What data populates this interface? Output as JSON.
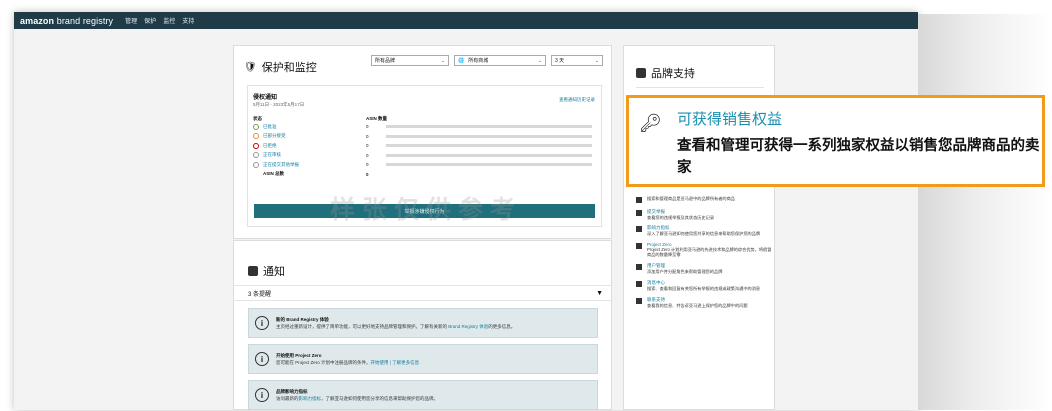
{
  "topbar": {
    "logo_bold": "amazon",
    "logo_rest": "brand registry",
    "nav": [
      "管理",
      "保护",
      "监控",
      "支持"
    ]
  },
  "protect": {
    "title": "保护和监控",
    "filters": [
      "所有品牌",
      "所有商城",
      "3 天"
    ],
    "notice_title": "侵权通知",
    "date_range": "5月11日 - 2023年5月17日",
    "history_link": "查看通知历史记录",
    "col_status": "状态",
    "col_asin": "ASIN 数量",
    "rows": [
      {
        "label": "已批准",
        "count": "0",
        "color": "#6aa84f"
      },
      {
        "label": "已部分接受",
        "count": "0",
        "color": "#e69138"
      },
      {
        "label": "已拒绝",
        "count": "0",
        "color": "#cc0000"
      },
      {
        "label": "正在审核",
        "count": "0",
        "color": "#999999"
      },
      {
        "label": "正在提交其他举报",
        "count": "0",
        "color": "#999999"
      }
    ],
    "total_label": "ASIN 总数",
    "total_value": "0",
    "button_label": "举报涉嫌侵权行为"
  },
  "watermark": "样张仅供参考",
  "notice": {
    "title": "通知",
    "count_label": "3 条提醒",
    "items": [
      {
        "title": "新的 Brand Registry 体验",
        "body_a": "主页经过重新设计，提供了简单功能，可以更好地支持品牌管理和保护。了解有关新的 ",
        "body_link": "Brand Registry 体验",
        "body_b": "的更多信息。"
      },
      {
        "title": "开始使用 Project Zero",
        "body_a": "您可能在 Project Zero 计划中注册品牌的条件。",
        "body_link": "开始使用 | 了解更多信息",
        "body_b": ""
      },
      {
        "title": "品牌影响力指标",
        "body_a": "访问最新的",
        "body_link": "影响力指标",
        "body_b": "，了解亚马逊如何使用您分享的信息来帮助保护您的品牌。"
      }
    ]
  },
  "support": {
    "title": "品牌支持",
    "quick_links": "快捷链接",
    "items": [
      {
        "label": "",
        "desc": "搜索和管理商品是亚马逊中的品牌所有者的商品"
      },
      {
        "label": "提交举报",
        "desc": "查看您的违规举报及其状态历史记录"
      },
      {
        "label": "影响力指标",
        "desc": "深入了解亚马逊如何使用您共享的信息来帮助您保护您的品牌"
      },
      {
        "label": "Project Zero",
        "desc": "Project Zero 计划利用亚马逊的先进技术和品牌的综合优势，将假冒商品的数量降至零"
      },
      {
        "label": "用户管理",
        "desc": "添加用户并分配角色来帮助管理您的品牌"
      },
      {
        "label": "消息中心",
        "desc": "搜索、查看和回复有关您所有举报的违规或政策沟通中的消息"
      },
      {
        "label": "联系支持",
        "desc": "查看我的信息、并告诉亚马逊上保护您的品牌中的问题"
      }
    ]
  },
  "callout": {
    "title": "可获得销售权益",
    "desc": "查看和管理可获得一系列独家权益以销售您品牌商品的卖家"
  }
}
